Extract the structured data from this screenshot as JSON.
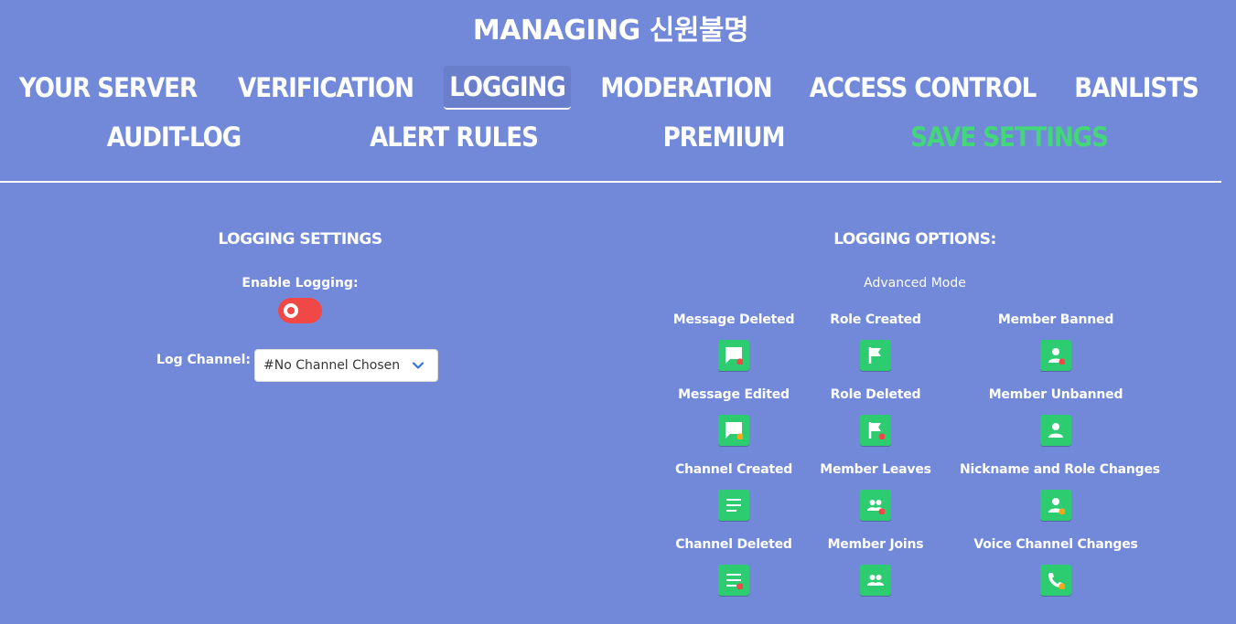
{
  "header": {
    "title": "MANAGING 신원불명"
  },
  "nav": {
    "row1": [
      "YOUR SERVER",
      "VERIFICATION",
      "LOGGING",
      "MODERATION",
      "ACCESS CONTROL",
      "BANLISTS"
    ],
    "row2": [
      "AUDIT-LOG",
      "ALERT RULES",
      "PREMIUM",
      "SAVE SETTINGS"
    ],
    "active": "LOGGING",
    "save_color": "#43d67a"
  },
  "settings": {
    "title": "LOGGING SETTINGS",
    "enable_label": "Enable Logging:",
    "enable_state": "off",
    "channel_label": "Log Channel:",
    "channel_value": "#No Channel Chosen"
  },
  "options": {
    "title": "LOGGING OPTIONS:",
    "mode": "Advanced Mode",
    "items": [
      {
        "label": "Message Deleted",
        "icon": "message-icon",
        "badge": "red"
      },
      {
        "label": "Role Created",
        "icon": "flag-icon",
        "badge": "none"
      },
      {
        "label": "Member Banned",
        "icon": "member-icon",
        "badge": "red"
      },
      {
        "label": "Message Edited",
        "icon": "message-icon",
        "badge": "orange"
      },
      {
        "label": "Role Deleted",
        "icon": "flag-icon",
        "badge": "red"
      },
      {
        "label": "Member Unbanned",
        "icon": "member-icon",
        "badge": "none"
      },
      {
        "label": "Channel Created",
        "icon": "list-icon",
        "badge": "none"
      },
      {
        "label": "Member Leaves",
        "icon": "members-icon",
        "badge": "red"
      },
      {
        "label": "Nickname and Role Changes",
        "icon": "member-icon",
        "badge": "orange"
      },
      {
        "label": "Channel Deleted",
        "icon": "list-icon",
        "badge": "red"
      },
      {
        "label": "Member Joins",
        "icon": "members-icon",
        "badge": "none"
      },
      {
        "label": "Voice Channel Changes",
        "icon": "phone-icon",
        "badge": "orange"
      }
    ]
  },
  "colors": {
    "background": "#7289da",
    "button_green": "#2ecc71",
    "badge_red": "#f04747",
    "badge_orange": "#faa61a",
    "toggle_off": "#f04747"
  }
}
